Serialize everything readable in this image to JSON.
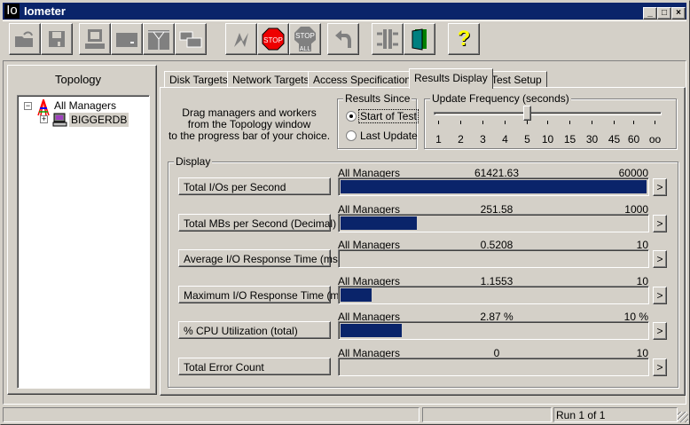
{
  "window": {
    "logo": "Io",
    "title": "Iometer"
  },
  "toolbar": [
    "open-icon",
    "save-icon",
    "start-new-manager-icon",
    "start-new-disk-worker-icon",
    "start-new-network-worker-icon",
    "duplicate-worker-icon",
    "start-tests-icon",
    "stop-icon",
    "stop-all-icon",
    "reset-workers-icon",
    "disconnect-icon",
    "exit-icon",
    "about-icon"
  ],
  "toolbar_text": {
    "stop": "STOP",
    "stop_all_top": "STOP",
    "stop_all_bottom": "ALL",
    "help": "?"
  },
  "topology": {
    "title": "Topology",
    "root": "All Managers",
    "child": "BIGGERDB"
  },
  "tabs": [
    "Disk Targets",
    "Network Targets",
    "Access Specifications",
    "Results Display",
    "Test Setup"
  ],
  "active_tab": "Results Display",
  "instructions": [
    "Drag managers and workers",
    "from the Topology window",
    "to the progress bar of your choice."
  ],
  "results_since": {
    "title": "Results Since",
    "options": [
      "Start of Test",
      "Last Update"
    ],
    "selected": "Start of Test"
  },
  "update_frequency": {
    "title": "Update Frequency (seconds)",
    "ticks": [
      "1",
      "2",
      "3",
      "4",
      "5",
      "10",
      "15",
      "30",
      "45",
      "60",
      "oo"
    ],
    "selected_index": 4
  },
  "display": {
    "title": "Display",
    "rows": [
      {
        "label": "Total I/Os per Second",
        "source": "All Managers",
        "value": "61421.63",
        "max": "60000",
        "fill": 1.0
      },
      {
        "label": "Total MBs per Second (Decimal)",
        "source": "All Managers",
        "value": "251.58",
        "max": "1000",
        "fill": 0.25
      },
      {
        "label": "Average I/O Response Time (ms)",
        "source": "All Managers",
        "value": "0.5208",
        "max": "10",
        "fill": 0.0
      },
      {
        "label": "Maximum I/O Response Time (ms)",
        "source": "All Managers",
        "value": "1.1553",
        "max": "10",
        "fill": 0.1
      },
      {
        "label": "% CPU Utilization (total)",
        "source": "All Managers",
        "value": "2.87 %",
        "max": "10 %",
        "fill": 0.2
      },
      {
        "label": "Total Error Count",
        "source": "All Managers",
        "value": "0",
        "max": "10",
        "fill": 0.0
      }
    ],
    "more_label": ">"
  },
  "status": {
    "run": "Run 1 of 1"
  },
  "colors": {
    "titlebar": "#0a246a",
    "bar": "#0a246a"
  }
}
